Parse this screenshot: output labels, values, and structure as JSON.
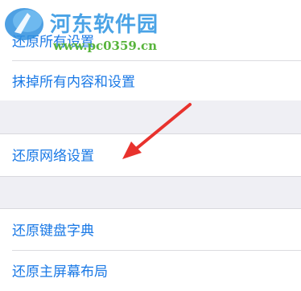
{
  "settings_list": {
    "rows": [
      {
        "label": "还原所有设置"
      },
      {
        "label": "抹掉所有内容和设置"
      },
      {
        "label": "还原网络设置"
      },
      {
        "label": "还原键盘字典"
      },
      {
        "label": "还原主屏幕布局"
      }
    ]
  },
  "watermark": {
    "title": "河东软件园",
    "url": "www.pc0359.cn"
  },
  "colors": {
    "link_blue": "#1a79e6",
    "background": "#efeff4",
    "arrow_red": "#e8322d"
  }
}
